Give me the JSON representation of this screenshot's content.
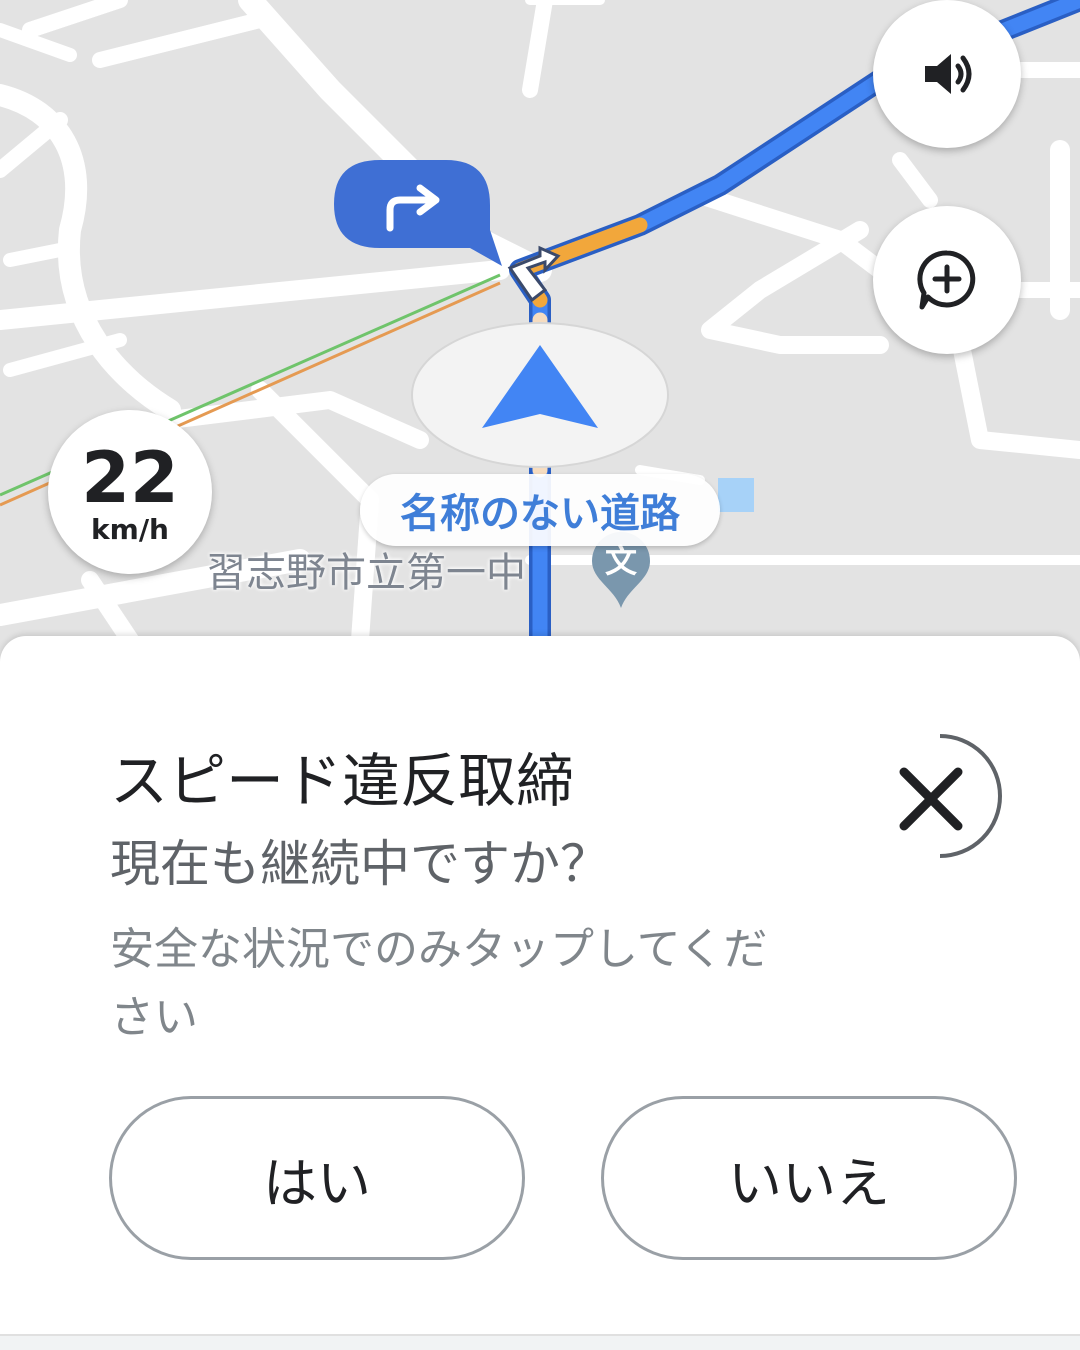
{
  "map": {
    "speed_value": "22",
    "speed_unit": "km/h",
    "current_road": "名称のない道路",
    "place_label": "習志野市立第一中",
    "school_glyph": "文",
    "route_color": "#4285f4",
    "traffic_slow_color": "#f2a73b",
    "turn_bubble_color": "#3f6fd4"
  },
  "alert": {
    "title": "スピード違反取締",
    "question": "現在も継続中ですか？",
    "caution": "安全な状況でのみタップしてください",
    "yes_label": "はい",
    "no_label": "いいえ"
  }
}
